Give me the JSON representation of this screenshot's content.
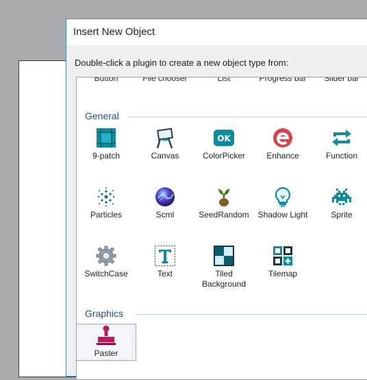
{
  "dialog": {
    "title": "Insert New Object",
    "instruction": "Double-click a plugin to create a new object type from:"
  },
  "cut_row": [
    "Button",
    "File chooser",
    "List",
    "Progress bar",
    "Slider bar"
  ],
  "groups": [
    {
      "title": "General",
      "items": [
        {
          "label": "9-patch",
          "icon": "nine-patch-icon"
        },
        {
          "label": "Canvas",
          "icon": "canvas-easel-icon"
        },
        {
          "label": "ColorPicker",
          "icon": "colorpicker-ok-icon"
        },
        {
          "label": "Enhance",
          "icon": "enhance-e-icon"
        },
        {
          "label": "Function",
          "icon": "function-arrows-icon"
        },
        {
          "label": "Particles",
          "icon": "particles-icon"
        },
        {
          "label": "Scml",
          "icon": "scml-orb-icon"
        },
        {
          "label": "SeedRandom",
          "icon": "seed-sprout-icon"
        },
        {
          "label": "Shadow Light",
          "icon": "bulb-icon"
        },
        {
          "label": "Sprite",
          "icon": "space-invader-icon"
        },
        {
          "label": "SwitchCase",
          "icon": "gear-icon"
        },
        {
          "label": "Text",
          "icon": "text-t-icon"
        },
        {
          "label": "Tiled Background",
          "icon": "tiled-background-icon"
        },
        {
          "label": "Tilemap",
          "icon": "tilemap-icon"
        }
      ]
    },
    {
      "title": "Graphics",
      "items": [
        {
          "label": "Paster",
          "icon": "paster-stamp-icon"
        }
      ]
    }
  ],
  "colors": {
    "accent": "#3e8fd0",
    "group_title": "#1f4e8c",
    "teal": "#0f8ba0",
    "enhance_red": "#d9434b",
    "paster_magenta": "#c0195b"
  }
}
